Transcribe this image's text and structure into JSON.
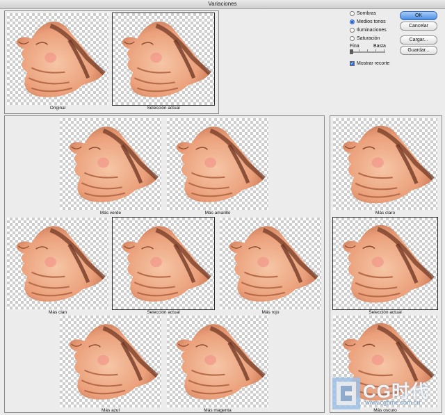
{
  "window": {
    "title": "Variaciones"
  },
  "top_previews": [
    {
      "caption": "Original",
      "selected": false
    },
    {
      "caption": "Selección actual",
      "selected": true
    }
  ],
  "color_variations": [
    {
      "caption": "Más verde",
      "selected": false
    },
    {
      "caption": "Más amarillo",
      "selected": false
    },
    {
      "caption": "Más cian",
      "selected": false
    },
    {
      "caption": "Selección actual",
      "selected": true
    },
    {
      "caption": "Más rojo",
      "selected": false
    },
    {
      "caption": "Más azul",
      "selected": false
    },
    {
      "caption": "Más magenta",
      "selected": false
    }
  ],
  "brightness_variations": [
    {
      "caption": "Más claro",
      "selected": false
    },
    {
      "caption": "Selección actual",
      "selected": true
    },
    {
      "caption": "Más oscuro",
      "selected": false
    }
  ],
  "tone_options": [
    {
      "label": "Sombras",
      "checked": false
    },
    {
      "label": "Medios tonos",
      "checked": true
    },
    {
      "label": "Iluminaciones",
      "checked": false
    },
    {
      "label": "Saturación",
      "checked": false
    }
  ],
  "slider": {
    "left_label": "Fina",
    "right_label": "Basta",
    "level": 0.0
  },
  "show_clipping": {
    "label": "Mostrar recorte",
    "checked": true
  },
  "buttons": {
    "ok": "OK",
    "cancel": "Cancelar",
    "load": "Cargar...",
    "save": "Guardar..."
  },
  "watermark": {
    "brand": "CG时代",
    "url": "www.cgtime.com.cn"
  },
  "colors": {
    "skin": "#eda681",
    "shadow": "#6b3320",
    "accent": "#4c8fe6"
  }
}
